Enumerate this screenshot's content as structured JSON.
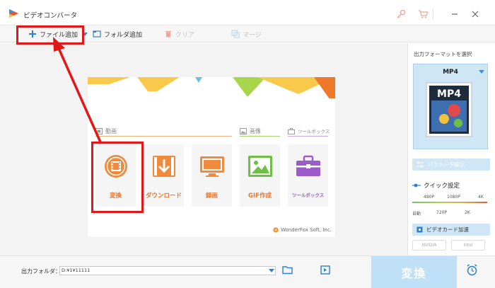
{
  "app": {
    "title": "ビデオコンバータ"
  },
  "titlebar": {
    "icons": [
      "key-icon",
      "cart-icon",
      "minimize-icon",
      "close-icon"
    ]
  },
  "toolbar": {
    "add_file": "ファイル追加",
    "add_folder": "フォルダ追加",
    "clear": "クリア",
    "merge": "マージ"
  },
  "main": {
    "sections": {
      "video": "動画",
      "image": "画像",
      "toolbox": "ツールボックス"
    },
    "tiles": [
      {
        "label": "変換",
        "icon": "film-convert-icon"
      },
      {
        "label": "ダウンロード",
        "icon": "download-icon"
      },
      {
        "label": "録画",
        "icon": "screen-record-icon"
      },
      {
        "label": "GIF作成",
        "icon": "image-gif-icon"
      },
      {
        "label": "ツールボックス",
        "icon": "toolbox-icon"
      }
    ],
    "credit": "WonderFox Soft, Inc."
  },
  "panel": {
    "title": "出力フォーマットを選択",
    "format": "MP4",
    "format_badge": "MP4",
    "param_button": "パラメータ設定",
    "quick_label": "クイック設定",
    "quality_top": [
      "480P",
      "1080P",
      "4K"
    ],
    "quality_bottom": [
      "自動",
      "720P",
      "2K"
    ],
    "gpu_button": "ビデオカード加速",
    "gpu_chips": [
      "NVIDIA",
      "Intel"
    ]
  },
  "bottom": {
    "output_label": "出力フォルダ：",
    "output_path": "D:¥1¥11111",
    "convert": "変換"
  },
  "colors": {
    "accent": "#3a8fd8",
    "orange": "#e8782e",
    "highlight": "#e01818"
  }
}
